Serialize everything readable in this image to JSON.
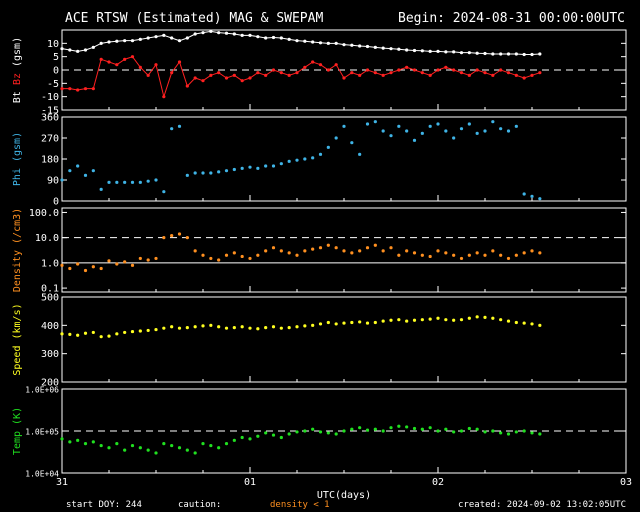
{
  "header": {
    "title": "ACE RTSW (Estimated) MAG & SWEPAM",
    "begin": "Begin: 2024-08-31 00:00:00UTC"
  },
  "footer": {
    "start_doy": "start DOY: 244",
    "caution": "caution:",
    "density_note": "density < 1",
    "created": "created: 2024-09-02 13:02:05UTC"
  },
  "colors": {
    "bt": "#ffffff",
    "bz": "#ff2020",
    "phi": "#3fb4e6",
    "density": "#ff9020",
    "speed": "#ffff20",
    "temp": "#20e020",
    "axis": "#ffffff",
    "background": "#000000"
  },
  "chart_data": [
    {
      "type": "line",
      "id": "mag",
      "ylabel_prefix": "Bt",
      "ylabel_bz": "Bz",
      "ylabel_suffix": "(gsm)",
      "ylim": [
        -15,
        15
      ],
      "yticks": [
        10,
        5,
        0,
        -5,
        -10,
        -15
      ],
      "ytick_labels": [
        "10",
        "5",
        "0",
        "-5",
        "-10",
        "-15"
      ],
      "dashed_at": [
        0
      ],
      "x_units": "hours since 2024-08-31 00:00 UTC",
      "xlim": [
        0,
        72
      ],
      "series": [
        {
          "name": "Bt",
          "color": "#ffffff",
          "x": [
            0,
            1,
            2,
            3,
            4,
            5,
            6,
            7,
            8,
            9,
            10,
            11,
            12,
            13,
            14,
            15,
            16,
            17,
            18,
            19,
            20,
            21,
            22,
            23,
            24,
            25,
            26,
            27,
            28,
            29,
            30,
            31,
            32,
            33,
            34,
            35,
            36,
            37,
            38,
            39,
            40,
            41,
            42,
            43,
            44,
            45,
            46,
            47,
            48,
            49,
            50,
            51,
            52,
            53,
            54,
            55,
            56,
            57,
            58,
            59,
            60,
            61
          ],
          "y": [
            8,
            7.5,
            7,
            7.5,
            8.5,
            10,
            10.5,
            10.8,
            11,
            11,
            11.5,
            12,
            12.5,
            13,
            12,
            11,
            12,
            13.5,
            14,
            14.5,
            14,
            13.8,
            13.5,
            13,
            13,
            12.5,
            12,
            12.2,
            12,
            11.5,
            11,
            10.8,
            10.5,
            10.2,
            10,
            10,
            9.5,
            9.3,
            9,
            8.8,
            8.5,
            8.2,
            8,
            7.8,
            7.5,
            7.3,
            7.2,
            7,
            7,
            6.8,
            6.8,
            6.5,
            6.5,
            6.3,
            6.2,
            6,
            6,
            6,
            6,
            5.8,
            5.8,
            6
          ]
        },
        {
          "name": "Bz",
          "color": "#ff2020",
          "x": [
            0,
            1,
            2,
            3,
            4,
            5,
            6,
            7,
            8,
            9,
            10,
            11,
            12,
            13,
            14,
            15,
            16,
            17,
            18,
            19,
            20,
            21,
            22,
            23,
            24,
            25,
            26,
            27,
            28,
            29,
            30,
            31,
            32,
            33,
            34,
            35,
            36,
            37,
            38,
            39,
            40,
            41,
            42,
            43,
            44,
            45,
            46,
            47,
            48,
            49,
            50,
            51,
            52,
            53,
            54,
            55,
            56,
            57,
            58,
            59,
            60,
            61
          ],
          "y": [
            -7,
            -7,
            -7.5,
            -7,
            -7,
            4,
            3,
            2,
            4,
            5,
            1,
            -2,
            2,
            -10,
            -1,
            3,
            -6,
            -3,
            -4,
            -2,
            -1,
            -3,
            -2,
            -4,
            -3,
            -1,
            -2,
            0,
            -1,
            -2,
            -1,
            1,
            3,
            2,
            0,
            2,
            -3,
            -1,
            -2,
            0,
            -1,
            -2,
            -1,
            0,
            1,
            0,
            -1,
            -2,
            0,
            1,
            0,
            -1,
            -2,
            0,
            -1,
            -2,
            0,
            -1,
            -2,
            -3,
            -2,
            -1
          ]
        }
      ]
    },
    {
      "type": "scatter",
      "id": "phi",
      "ylabel": "Phi (gsm)",
      "ylim": [
        0,
        360
      ],
      "yticks": [
        360,
        270,
        180,
        90,
        0
      ],
      "ytick_labels": [
        "360",
        "270",
        "180",
        "90",
        "0"
      ],
      "x_units": "hours since 2024-08-31 00:00 UTC",
      "xlim": [
        0,
        72
      ],
      "series": [
        {
          "name": "Phi",
          "color": "#3fb4e6",
          "x": [
            0,
            1,
            2,
            3,
            4,
            5,
            6,
            7,
            8,
            9,
            10,
            11,
            12,
            13,
            14,
            15,
            16,
            17,
            18,
            19,
            20,
            21,
            22,
            23,
            24,
            25,
            26,
            27,
            28,
            29,
            30,
            31,
            32,
            33,
            34,
            35,
            36,
            37,
            38,
            39,
            40,
            41,
            42,
            43,
            44,
            45,
            46,
            47,
            48,
            49,
            50,
            51,
            52,
            53,
            54,
            55,
            56,
            57,
            58,
            59,
            60,
            61
          ],
          "y": [
            90,
            130,
            150,
            110,
            130,
            50,
            80,
            80,
            80,
            80,
            80,
            85,
            90,
            40,
            310,
            320,
            110,
            120,
            120,
            120,
            125,
            130,
            135,
            140,
            145,
            140,
            150,
            150,
            160,
            170,
            175,
            180,
            185,
            200,
            230,
            270,
            320,
            250,
            200,
            330,
            340,
            300,
            280,
            320,
            300,
            260,
            290,
            320,
            330,
            300,
            270,
            310,
            330,
            290,
            300,
            340,
            310,
            300,
            320,
            30,
            20,
            10
          ]
        }
      ]
    },
    {
      "type": "scatter",
      "id": "density",
      "ylabel": "Density (/cm3)",
      "yscale": "log",
      "ylim": [
        0.07,
        150
      ],
      "yticks": [
        100.0,
        10.0,
        1.0,
        0.1
      ],
      "ytick_labels": [
        "100.0",
        "10.0",
        "1.0",
        "0.1"
      ],
      "dashed_at": [
        10
      ],
      "solid_at": [
        1
      ],
      "x_units": "hours since 2024-08-31 00:00 UTC",
      "xlim": [
        0,
        72
      ],
      "series": [
        {
          "name": "Density",
          "color": "#ff9020",
          "x": [
            0,
            1,
            2,
            3,
            4,
            5,
            6,
            7,
            8,
            9,
            10,
            11,
            12,
            13,
            14,
            15,
            16,
            17,
            18,
            19,
            20,
            21,
            22,
            23,
            24,
            25,
            26,
            27,
            28,
            29,
            30,
            31,
            32,
            33,
            34,
            35,
            36,
            37,
            38,
            39,
            40,
            41,
            42,
            43,
            44,
            45,
            46,
            47,
            48,
            49,
            50,
            51,
            52,
            53,
            54,
            55,
            56,
            57,
            58,
            59,
            60,
            61
          ],
          "y": [
            0.8,
            0.6,
            0.9,
            0.5,
            0.7,
            0.6,
            1.2,
            0.9,
            1.1,
            0.8,
            1.5,
            1.3,
            1.5,
            10,
            12,
            14,
            10,
            3,
            2,
            1.5,
            1.3,
            2,
            2.5,
            1.8,
            1.5,
            2,
            3,
            4,
            3,
            2.5,
            2,
            3,
            3.5,
            4,
            5,
            4,
            3,
            2.5,
            3,
            4,
            5,
            3,
            4,
            2,
            3,
            2.5,
            2,
            1.8,
            3,
            2.5,
            2,
            1.5,
            2,
            2.5,
            2,
            3,
            2,
            1.5,
            2,
            2.5,
            3,
            2.5
          ]
        }
      ]
    },
    {
      "type": "scatter",
      "id": "speed",
      "ylabel": "Speed (km/s)",
      "ylim": [
        200,
        500
      ],
      "yticks": [
        500,
        400,
        300,
        200
      ],
      "ytick_labels": [
        "500",
        "400",
        "300",
        "200"
      ],
      "x_units": "hours since 2024-08-31 00:00 UTC",
      "xlim": [
        0,
        72
      ],
      "series": [
        {
          "name": "Speed",
          "color": "#ffff20",
          "x": [
            0,
            1,
            2,
            3,
            4,
            5,
            6,
            7,
            8,
            9,
            10,
            11,
            12,
            13,
            14,
            15,
            16,
            17,
            18,
            19,
            20,
            21,
            22,
            23,
            24,
            25,
            26,
            27,
            28,
            29,
            30,
            31,
            32,
            33,
            34,
            35,
            36,
            37,
            38,
            39,
            40,
            41,
            42,
            43,
            44,
            45,
            46,
            47,
            48,
            49,
            50,
            51,
            52,
            53,
            54,
            55,
            56,
            57,
            58,
            59,
            60,
            61
          ],
          "y": [
            370,
            368,
            365,
            372,
            375,
            360,
            362,
            370,
            375,
            378,
            380,
            382,
            385,
            390,
            395,
            390,
            392,
            395,
            398,
            400,
            395,
            390,
            392,
            395,
            390,
            388,
            392,
            395,
            390,
            392,
            395,
            398,
            400,
            405,
            410,
            405,
            408,
            410,
            412,
            408,
            410,
            415,
            418,
            420,
            415,
            418,
            420,
            422,
            425,
            420,
            418,
            420,
            425,
            430,
            428,
            425,
            420,
            415,
            410,
            408,
            405,
            400
          ]
        }
      ]
    },
    {
      "type": "scatter",
      "id": "temp",
      "ylabel": "Temp (K)",
      "yscale": "log",
      "ylim": [
        10000,
        1000000
      ],
      "yticks": [
        1000000,
        100000,
        10000
      ],
      "ytick_labels": [
        "1.0E+06",
        "1.0E+05",
        "1.0E+04"
      ],
      "dashed_at": [
        100000
      ],
      "x_units": "hours since 2024-08-31 00:00 UTC",
      "xlim": [
        0,
        72
      ],
      "xticks": [
        0,
        24,
        48,
        72
      ],
      "xtick_labels": [
        "31",
        "01",
        "02",
        "03"
      ],
      "xlabel": "UTC(days)",
      "series": [
        {
          "name": "Temp",
          "color": "#20e020",
          "x": [
            0,
            1,
            2,
            3,
            4,
            5,
            6,
            7,
            8,
            9,
            10,
            11,
            12,
            13,
            14,
            15,
            16,
            17,
            18,
            19,
            20,
            21,
            22,
            23,
            24,
            25,
            26,
            27,
            28,
            29,
            30,
            31,
            32,
            33,
            34,
            35,
            36,
            37,
            38,
            39,
            40,
            41,
            42,
            43,
            44,
            45,
            46,
            47,
            48,
            49,
            50,
            51,
            52,
            53,
            54,
            55,
            56,
            57,
            58,
            59,
            60,
            61
          ],
          "y": [
            65000,
            55000,
            60000,
            50000,
            55000,
            45000,
            40000,
            50000,
            35000,
            45000,
            40000,
            35000,
            30000,
            50000,
            45000,
            40000,
            35000,
            30000,
            50000,
            45000,
            40000,
            50000,
            60000,
            70000,
            65000,
            75000,
            90000,
            80000,
            70000,
            85000,
            95000,
            100000,
            110000,
            95000,
            90000,
            85000,
            100000,
            110000,
            120000,
            105000,
            110000,
            100000,
            120000,
            130000,
            125000,
            115000,
            110000,
            120000,
            100000,
            110000,
            95000,
            100000,
            115000,
            110000,
            95000,
            100000,
            90000,
            85000,
            95000,
            100000,
            90000,
            85000
          ]
        }
      ]
    }
  ]
}
